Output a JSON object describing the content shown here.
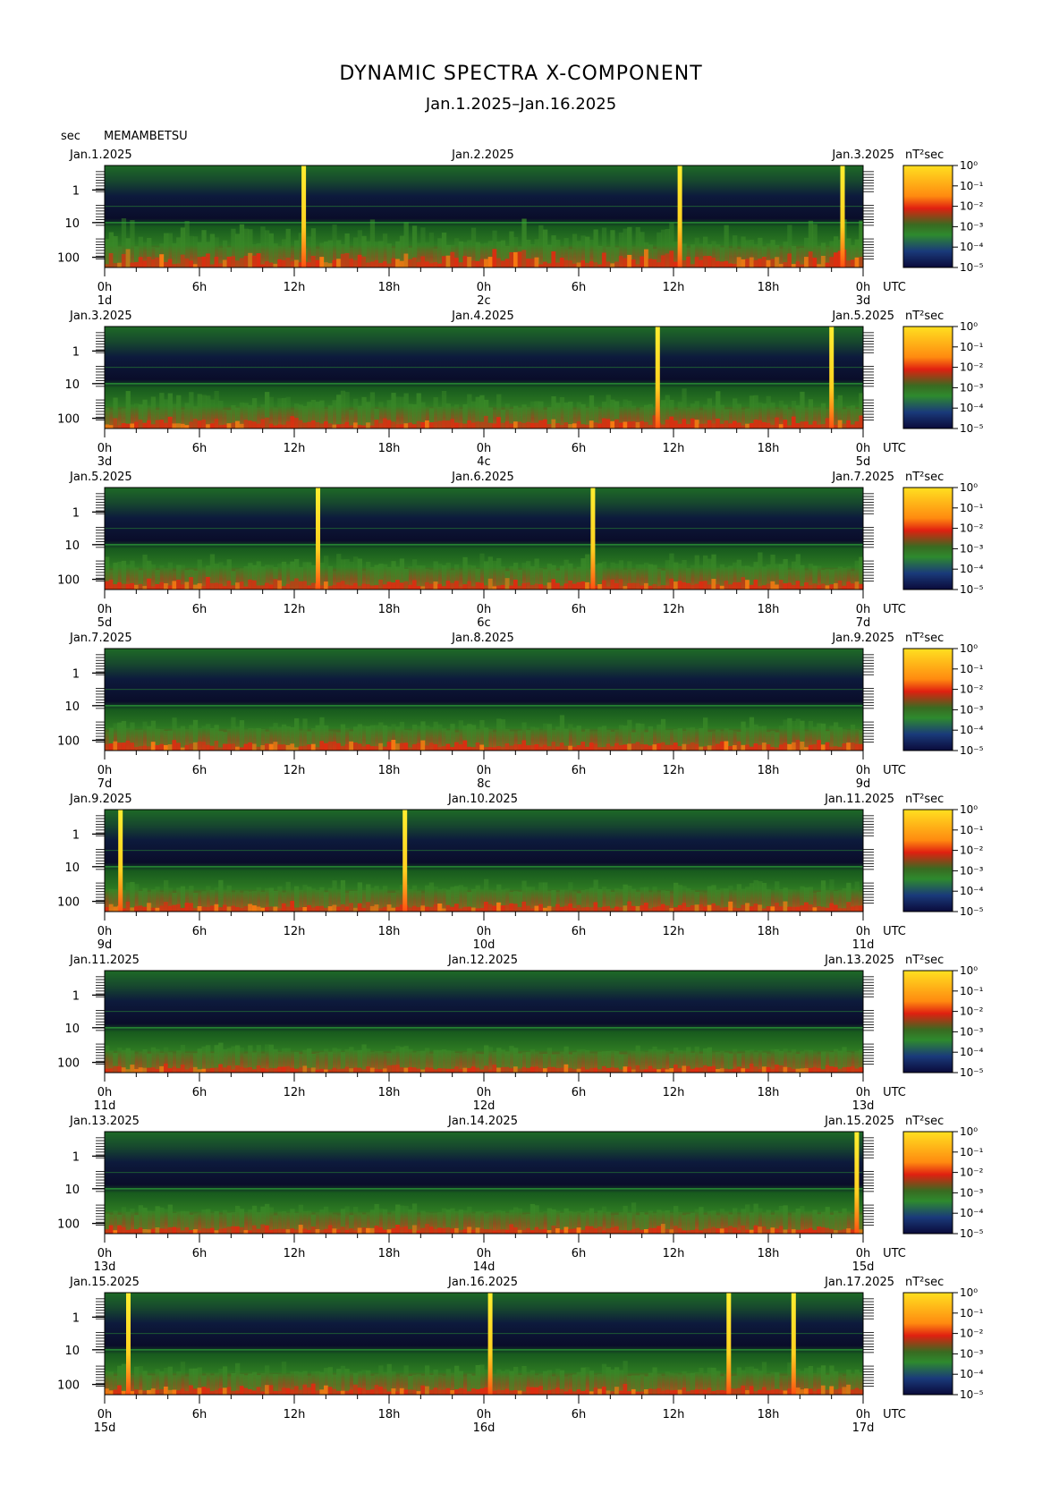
{
  "title": "DYNAMIC SPECTRA X-COMPONENT",
  "subtitle": "Jan.1.2025–Jan.16.2025",
  "y_unit_label": "sec",
  "station": "MEMAMBETSU",
  "colorbar_unit": "nT²sec",
  "colorbar_ticks": [
    "10⁰",
    "10⁻¹",
    "10⁻²",
    "10⁻³",
    "10⁻⁴",
    "10⁻⁵"
  ],
  "colors": {
    "low": "#0a0a3a",
    "mid_low": "#1a3a7a",
    "mid": "#2e8a2e",
    "mid_high": "#e02010",
    "high": "#ffe020"
  },
  "chart_data": {
    "type": "heatmap",
    "y_axis": {
      "label": "sec",
      "ticks": [
        "1",
        "10",
        "100"
      ],
      "scale": "log"
    },
    "x_ticks": [
      "0h",
      "6h",
      "12h",
      "18h",
      "0h",
      "6h",
      "12h",
      "18h",
      "0h"
    ],
    "x_unit": "UTC",
    "colorbar": {
      "unit": "nT²sec",
      "range_log10": [
        -5,
        0
      ]
    },
    "panels": [
      {
        "date_left": "Jan.1.2025",
        "date_mid": "Jan.2.2025",
        "date_right": "Jan.3.2025",
        "day_left": "1d",
        "day_mid": "2c",
        "day_right": "3d",
        "spikes_hours": [
          12.6,
          36.4,
          46.7
        ],
        "activity": 0.85
      },
      {
        "date_left": "Jan.3.2025",
        "date_mid": "Jan.4.2025",
        "date_right": "Jan.5.2025",
        "day_left": "3d",
        "day_mid": "4c",
        "day_right": "5d",
        "spikes_hours": [
          35.0,
          46.0
        ],
        "activity": 0.55
      },
      {
        "date_left": "Jan.5.2025",
        "date_mid": "Jan.6.2025",
        "date_right": "Jan.7.2025",
        "day_left": "5d",
        "day_mid": "6c",
        "day_right": "7d",
        "spikes_hours": [
          13.5,
          30.9
        ],
        "activity": 0.5
      },
      {
        "date_left": "Jan.7.2025",
        "date_mid": "Jan.8.2025",
        "date_right": "Jan.9.2025",
        "day_left": "7d",
        "day_mid": "8c",
        "day_right": "9d",
        "spikes_hours": [],
        "activity": 0.45
      },
      {
        "date_left": "Jan.9.2025",
        "date_mid": "Jan.10.2025",
        "date_right": "Jan.11.2025",
        "day_left": "9d",
        "day_mid": "10d",
        "day_right": "11d",
        "spikes_hours": [
          1.0,
          19.0
        ],
        "activity": 0.4
      },
      {
        "date_left": "Jan.11.2025",
        "date_mid": "Jan.12.2025",
        "date_right": "Jan.13.2025",
        "day_left": "11d",
        "day_mid": "12d",
        "day_right": "13d",
        "spikes_hours": [],
        "activity": 0.3
      },
      {
        "date_left": "Jan.13.2025",
        "date_mid": "Jan.14.2025",
        "date_right": "Jan.15.2025",
        "day_left": "13d",
        "day_mid": "14d",
        "day_right": "15d",
        "spikes_hours": [
          47.6
        ],
        "activity": 0.35
      },
      {
        "date_left": "Jan.15.2025",
        "date_mid": "Jan.16.2025",
        "date_right": "Jan.17.2025",
        "day_left": "15d",
        "day_mid": "16d",
        "day_right": "17d",
        "spikes_hours": [
          1.5,
          24.4,
          39.5,
          43.6
        ],
        "activity": 0.4
      }
    ]
  }
}
